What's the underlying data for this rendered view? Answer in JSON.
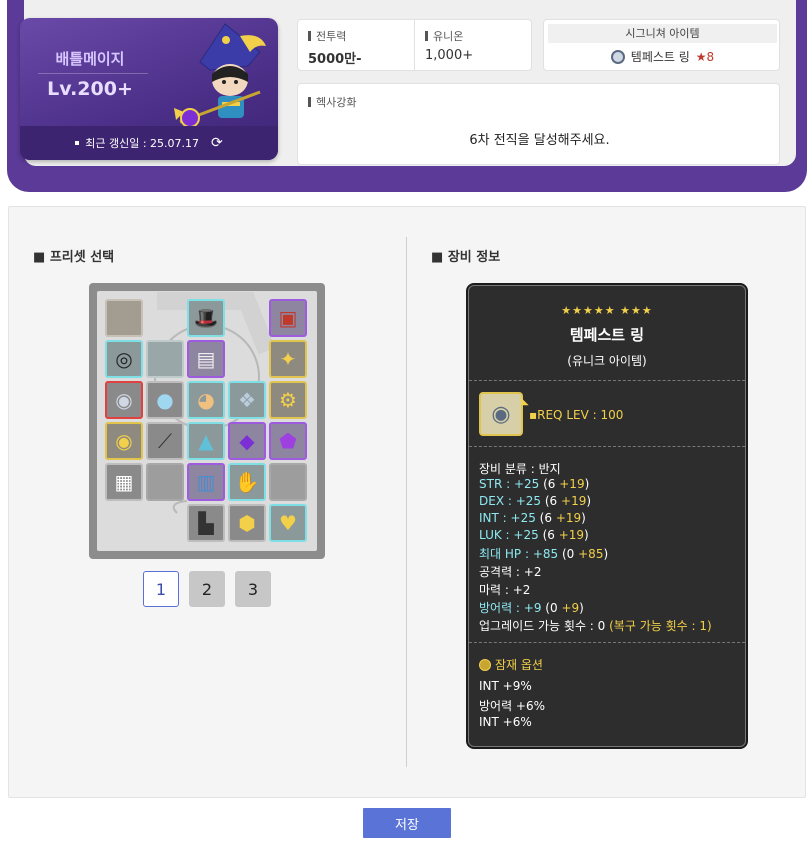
{
  "character": {
    "job": "배틀메이지",
    "level": "Lv.200+",
    "updated": "최근 갱신일 : 25.07.17"
  },
  "stats": {
    "combat_power_label": "전투력",
    "combat_power_value": "5000만-",
    "union_label": "유니온",
    "union_value": "1,000+",
    "signature_label": "시그니쳐 아이템",
    "signature_item_name": "템페스트 링",
    "signature_stars": "★8",
    "hexa_label": "헥사강화",
    "hexa_message": "6차 전직을 달성해주세요."
  },
  "preset": {
    "title": "프리셋 선택",
    "buttons": [
      "1",
      "2",
      "3"
    ],
    "active": "1"
  },
  "equipment": {
    "title": "장비 정보"
  },
  "tooltip": {
    "stars": "★★★★★ ★★★",
    "name": "템페스트 링",
    "grade": "(유니크 아이템)",
    "req_lev": "REQ LEV : 100",
    "category": "장비 분류 : 반지",
    "stat_lines": [
      {
        "label": "STR : +25",
        "base": "6",
        "bonus": "+19"
      },
      {
        "label": "DEX : +25",
        "base": "6",
        "bonus": "+19"
      },
      {
        "label": "INT : +25",
        "base": "6",
        "bonus": "+19"
      },
      {
        "label": "LUK : +25",
        "base": "6",
        "bonus": "+19"
      },
      {
        "label": "최대 HP : +85",
        "base": "0",
        "bonus": "+85"
      }
    ],
    "attack": "공격력 : +2",
    "magic": "마력 : +2",
    "defense": {
      "label": "방어력 : +9",
      "base": "0",
      "bonus": "+9"
    },
    "upgrade": "업그레이드 가능 횟수 : 0",
    "upgrade_recover": "(복구 가능 횟수 : 1)",
    "potential_title": "잠재 옵션",
    "potential_lines": [
      "INT +9%",
      "방어력 +6%",
      "INT +6%"
    ]
  },
  "save_label": "저장",
  "colors": {
    "purple_frame": "#5b3a98",
    "save_button": "#5a73d6",
    "unique_gold": "#f2d04a",
    "stat_cyan": "#8ee9f2"
  }
}
